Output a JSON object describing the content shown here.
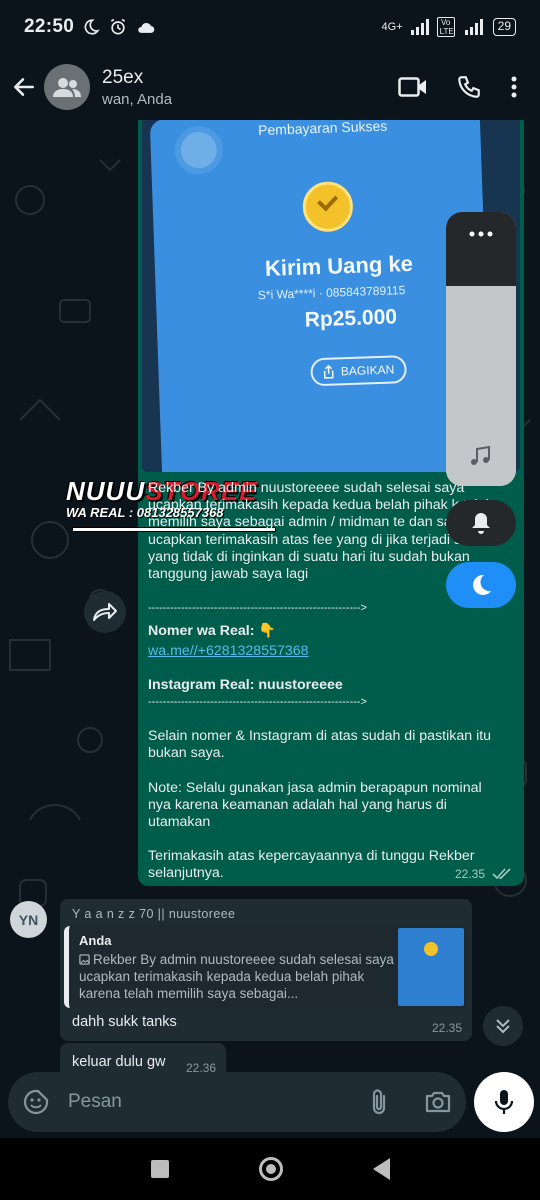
{
  "status_bar": {
    "time": "22:50",
    "network": "4G+",
    "volte": "Vo LTE",
    "battery": "29"
  },
  "header": {
    "title": "25ex",
    "subtitle": "wan, Anda",
    "icons": [
      "back-arrow-icon",
      "group-avatar-icon",
      "video-call-icon",
      "phone-icon",
      "more-vert-icon"
    ]
  },
  "shared_image": {
    "status": "Pembayaran Sukses",
    "title": "Kirim Uang ke",
    "recipient": "S*i Wa****i · 085843789115",
    "amount": "Rp25.000",
    "share_label": "BAGIKAN",
    "watermark_white": "NUUU",
    "watermark_red": "STOREE",
    "watermark_sub": "WA REAL : 081328557368"
  },
  "outgoing_message": {
    "intro": "Rekber By admin nuustoreeee sudah selesai saya ucapkan terimakasih kepada kedua belah pihak k telah memilih saya sebagai admin / midman te dan saya ucapkan terimakasih atas fee yang di jika terjadi sesuatu yang tidak di inginkan di suatu hari itu sudah bukan tanggung jawab saya lagi",
    "separator_1": "---------------------------------------------------------->",
    "wa_label": "Nomer wa Real:",
    "wa_emoji": "👇",
    "wa_link": "wa.me//+6281328557368",
    "ig_label": "Instagram Real: nuustoreeee",
    "separator_2": "---------------------------------------------------------->",
    "para_1": "Selain nomer & Instagram di atas sudah di pastikan itu bukan saya.",
    "para_2": "Note: Selalu gunakan jasa admin berapapun nominal nya karena keamanan adalah hal yang harus di utamakan",
    "para_3": "Terimakasih atas kepercayaannya di tunggu Rekber selanjutnya.",
    "time": "22.35"
  },
  "incoming_message_1": {
    "avatar_initials": "YN",
    "sender": "Y a a n z z 70 || nuustoreee",
    "quote_author": "Anda",
    "quote_text": "Rekber By admin nuustoreeee sudah selesai saya ucapkan terimakasih kepada kedua belah pihak karena telah memilih saya sebagai...",
    "text": "dahh sukk tanks",
    "time": "22.35"
  },
  "incoming_message_2": {
    "text": "keluar dulu gw",
    "time": "22.36"
  },
  "composer": {
    "placeholder": "Pesan"
  },
  "colors": {
    "outgoing_bubble": "#005c4b",
    "incoming_bubble": "#202c33",
    "background": "#0b141a",
    "link": "#53bdeb",
    "accent_blue": "#1f8ff7"
  }
}
